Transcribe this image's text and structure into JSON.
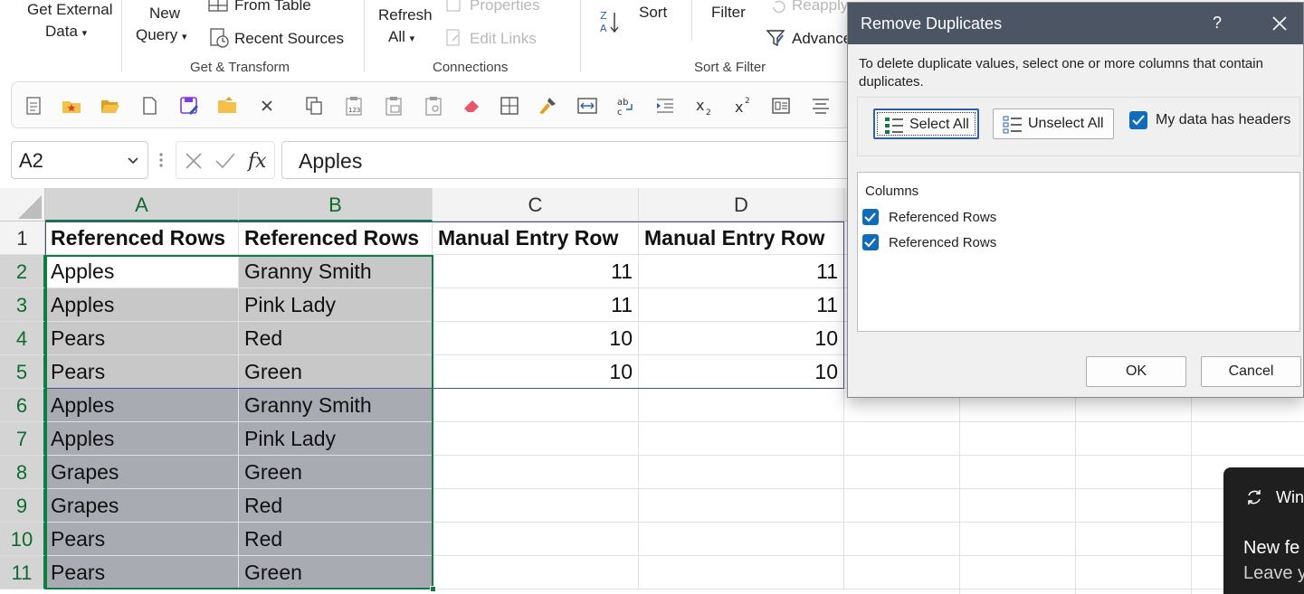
{
  "ribbon": {
    "get_external_data": [
      "Get External",
      "Data"
    ],
    "new_query": [
      "New",
      "Query"
    ],
    "from_table": "From Table",
    "recent_sources": "Recent Sources",
    "group_get_transform": "Get & Transform",
    "refresh_all": [
      "Refresh",
      "All"
    ],
    "properties": "Properties",
    "edit_links": "Edit Links",
    "group_connections": "Connections",
    "sort": "Sort",
    "filter": "Filter",
    "reapply": "Reapply",
    "advanced": "Advanced",
    "group_sort_filter": "Sort & Filter"
  },
  "formula_bar": {
    "name_box": "A2",
    "formula": "Apples"
  },
  "sheet": {
    "columns": [
      "A",
      "B",
      "C",
      "D"
    ],
    "rows": [
      {
        "n": "1",
        "cells": [
          "Referenced Rows",
          "Referenced Rows",
          "Manual Entry Row",
          "Manual Entry Row"
        ]
      },
      {
        "n": "2",
        "cells": [
          "Apples",
          "Granny Smith",
          "11",
          "11"
        ]
      },
      {
        "n": "3",
        "cells": [
          "Apples",
          "Pink Lady",
          "11",
          "11"
        ]
      },
      {
        "n": "4",
        "cells": [
          "Pears",
          "Red",
          "10",
          "10"
        ]
      },
      {
        "n": "5",
        "cells": [
          "Pears",
          "Green",
          "10",
          "10"
        ]
      },
      {
        "n": "6",
        "cells": [
          "Apples",
          "Granny Smith",
          "",
          ""
        ]
      },
      {
        "n": "7",
        "cells": [
          "Apples",
          "Pink Lady",
          "",
          ""
        ]
      },
      {
        "n": "8",
        "cells": [
          "Grapes",
          "Green",
          "",
          ""
        ]
      },
      {
        "n": "9",
        "cells": [
          "Grapes",
          "Red",
          "",
          ""
        ]
      },
      {
        "n": "10",
        "cells": [
          "Pears",
          "Red",
          "",
          ""
        ]
      },
      {
        "n": "11",
        "cells": [
          "Pears",
          "Green",
          "",
          ""
        ]
      }
    ]
  },
  "dialog": {
    "title": "Remove Duplicates",
    "help": "?",
    "description": "To delete duplicate values, select one or more columns that contain duplicates.",
    "select_all": "Select All",
    "unselect_all": "Unselect All",
    "my_data_has_headers": "My data has headers",
    "columns_title": "Columns",
    "column_items": [
      "Referenced Rows",
      "Referenced Rows"
    ],
    "ok": "OK",
    "cancel": "Cancel"
  },
  "toast": {
    "title": "Win",
    "line1": "New fe",
    "line2": "Leave y"
  },
  "colors": {
    "excel_green": "#107c41",
    "dialog_title": "#4b5563",
    "checkbox_blue": "#0f6cbd",
    "selection_gray": "#c8c8c8"
  }
}
